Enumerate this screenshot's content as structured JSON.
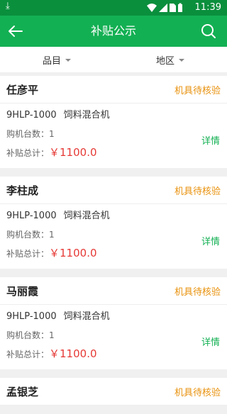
{
  "status": {
    "time": "11:39",
    "download_icon": "download-icon",
    "icons": [
      "wifi-icon",
      "signal-icon",
      "no-sim-icon",
      "battery-icon"
    ]
  },
  "app": {
    "title": "补贴公示",
    "back_icon": "arrow-back-icon",
    "search_icon": "search-icon",
    "accent": "#13b053"
  },
  "filters": [
    {
      "label": "品目"
    },
    {
      "label": "地区"
    }
  ],
  "records": [
    {
      "name": "任彦平",
      "status": "机具待核验",
      "model": "9HLP-1000",
      "product": "饲料混合机",
      "qty_label": "购机台数：",
      "qty": "1",
      "subsidy_label": "补贴总计：",
      "subsidy": "￥1100.0",
      "detail": "详情"
    },
    {
      "name": "李柱成",
      "status": "机具待核验",
      "model": "9HLP-1000",
      "product": "饲料混合机",
      "qty_label": "购机台数：",
      "qty": "1",
      "subsidy_label": "补贴总计：",
      "subsidy": "￥1100.0",
      "detail": "详情"
    },
    {
      "name": "马丽霞",
      "status": "机具待核验",
      "model": "9HLP-1000",
      "product": "饲料混合机",
      "qty_label": "购机台数：",
      "qty": "1",
      "subsidy_label": "补贴总计：",
      "subsidy": "￥1100.0",
      "detail": "详情"
    },
    {
      "name": "孟银芝",
      "status": "机具待核验"
    }
  ]
}
